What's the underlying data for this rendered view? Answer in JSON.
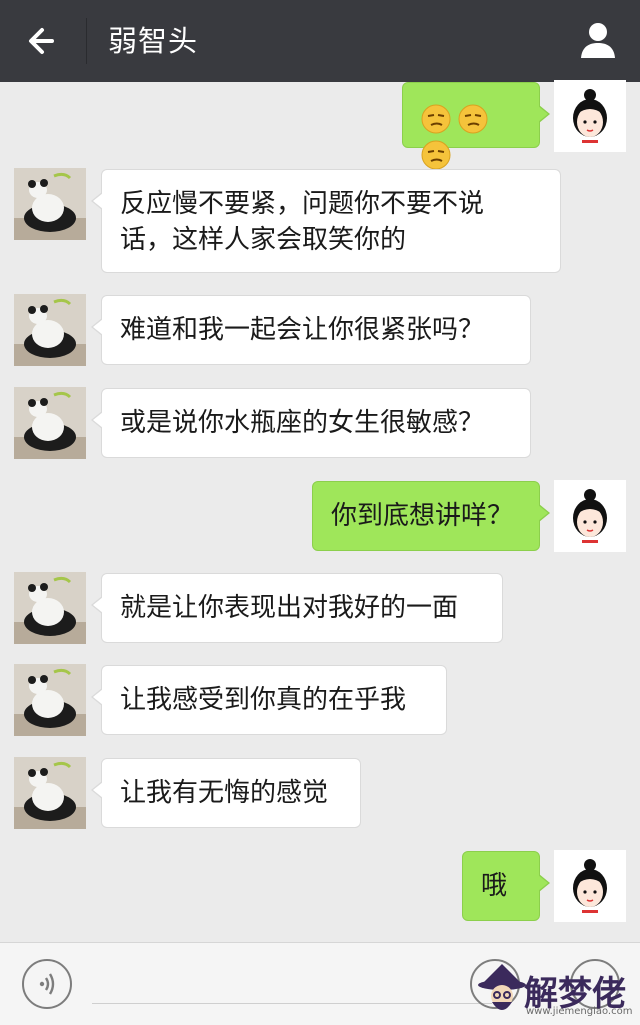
{
  "header": {
    "title": "弱智头",
    "back_icon": "arrow-left-icon",
    "profile_icon": "person-icon"
  },
  "messages": [
    {
      "side": "right",
      "emoji": [
        "smirk-emoji",
        "smirk-emoji",
        "smirk-emoji"
      ]
    },
    {
      "side": "left",
      "lines": [
        "反应慢不要紧，问题你不要不说",
        "话，这样人家会取笑你的"
      ]
    },
    {
      "side": "left",
      "lines": [
        "难道和我一起会让你很紧张吗？"
      ]
    },
    {
      "side": "left",
      "lines": [
        "或是说你水瓶座的女生很敏感？"
      ]
    },
    {
      "side": "right",
      "lines": [
        "你到底想讲咩？"
      ]
    },
    {
      "side": "left",
      "lines": [
        "就是让你表现出对我好的一面"
      ]
    },
    {
      "side": "left",
      "lines": [
        "让我感受到你真的在乎我"
      ]
    },
    {
      "side": "left",
      "lines": [
        "让我有无悔的感觉"
      ]
    },
    {
      "side": "right",
      "lines": [
        "哦"
      ]
    }
  ],
  "avatars": {
    "left": "panda-avatar",
    "right": "girl-avatar"
  },
  "bottom": {
    "voice_icon": "voice-icon",
    "watermark_text": "解梦佬",
    "watermark_url": "www.jiemenglao.com"
  },
  "colors": {
    "header_bg": "#393a3f",
    "chat_bg": "#ebebeb",
    "self_bubble": "#9fe65a",
    "other_bubble": "#ffffff"
  }
}
